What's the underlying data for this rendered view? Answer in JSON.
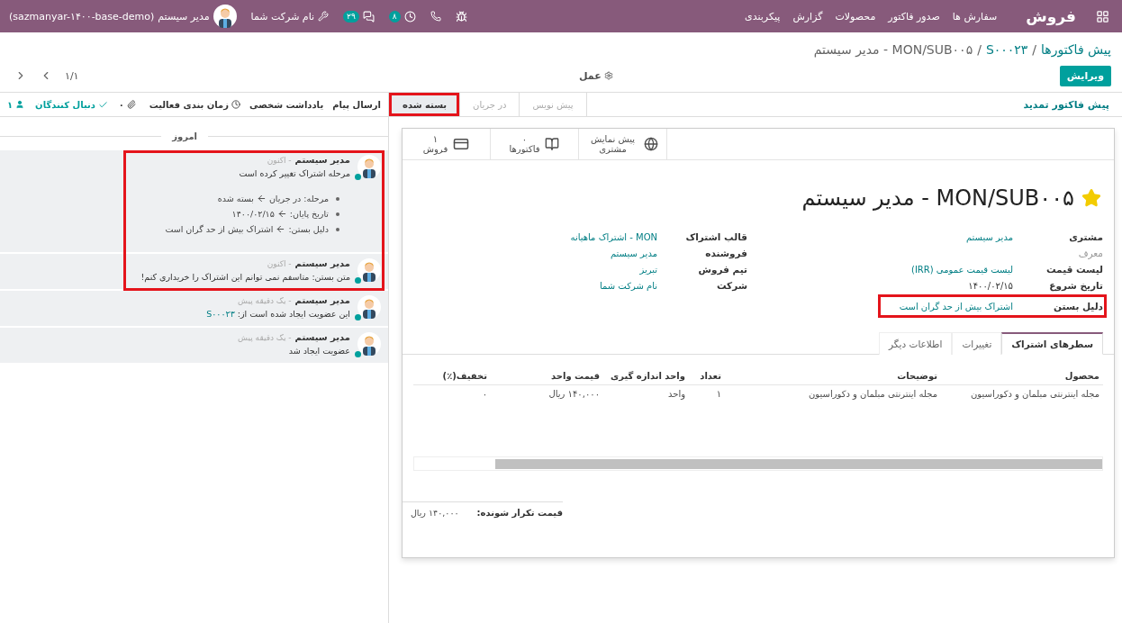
{
  "navbar": {
    "app_name": "فروش",
    "menu": [
      "سفارش ها",
      "صدور فاکتور",
      "محصولات",
      "گزارش",
      "پیکربندی"
    ],
    "systray": [
      {
        "kind": "bug"
      },
      {
        "kind": "phone"
      },
      {
        "kind": "activity",
        "badge": "۸"
      },
      {
        "kind": "messages",
        "badge": "۲۹"
      },
      {
        "kind": "company",
        "label": "نام شرکت شما"
      },
      {
        "kind": "user",
        "label": "مدیر سیستم",
        "db": "(sazmanyar-۱۴۰۰-base-demo)"
      }
    ]
  },
  "breadcrumbs": [
    {
      "label": "پیش فاکتورها",
      "link": true,
      "separator": "/"
    },
    {
      "label": "S۰۰۰۲۳",
      "link": true,
      "separator": "/"
    },
    {
      "label": "MON/SUB۰۰۵ - مدیر سیستم",
      "link": false
    }
  ],
  "edit_button": "ویرایش",
  "action_menu": "عمل",
  "pager": "۱/۱",
  "status_bar": {
    "button": "پیش فاکتور تمدید",
    "stages": [
      {
        "label": "پیش نویس",
        "selected": false,
        "highlighted": false
      },
      {
        "label": "در جریان",
        "selected": false,
        "highlighted": false
      },
      {
        "label": "بسته شده",
        "selected": true,
        "highlighted": true
      }
    ]
  },
  "stat_buttons": [
    {
      "kind": "globe",
      "label": "پیش نمایش مشتری"
    },
    {
      "kind": "book",
      "value": "۰",
      "label": "فاکتورها"
    },
    {
      "kind": "card",
      "value": "۱",
      "label": "فروش"
    }
  ],
  "title": "MON/SUB۰۰۵ - مدیر سیستم",
  "starred": true,
  "field_columns": [
    [
      {
        "label": "مشتری",
        "value": "مدیر سیستم",
        "link": true,
        "muted": false,
        "highlighted": false
      },
      {
        "label": "معرف",
        "muted": true,
        "highlighted": false
      },
      {
        "label": "لیست قیمت",
        "value": "لیست قیمت عمومی (IRR)",
        "link": true,
        "muted": false,
        "highlighted": false
      },
      {
        "label": "تاریخ شروع",
        "value": "۱۴۰۰/۰۲/۱۵",
        "link": false,
        "muted": false,
        "highlighted": false
      },
      {
        "label": "دلیل بستن",
        "value": "اشتراک بیش از حد گران است",
        "link": true,
        "muted": false,
        "highlighted": true
      }
    ],
    [
      {
        "label": "قالب اشتراک",
        "value": "MON - اشتراک ماهیانه",
        "link": true,
        "muted": false,
        "highlighted": false
      },
      {
        "label": "فروشنده",
        "value": "مدیر سیستم",
        "link": true,
        "muted": false,
        "highlighted": false
      },
      {
        "label": "تیم فروش",
        "value": "تبریز",
        "link": true,
        "muted": false,
        "highlighted": false
      },
      {
        "label": "شرکت",
        "value": "نام شرکت شما",
        "link": true,
        "muted": false,
        "highlighted": false
      }
    ]
  ],
  "tabs": [
    {
      "label": "سطرهای اشتراک",
      "selected": true
    },
    {
      "label": "تغییرات",
      "selected": false
    },
    {
      "label": "اطلاعات دیگر",
      "selected": false
    }
  ],
  "table": {
    "columns": [
      "محصول",
      "توضیحات",
      "تعداد",
      "واحد اندازه گیری",
      "قیمت واحد",
      "تخفیف(٪)"
    ],
    "rows": [
      [
        "مجله اینترنتی مبلمان و دکوراسیون",
        "مجله اینترنتی مبلمان و دکوراسیون",
        "۱",
        "واحد",
        "۱۴۰,۰۰۰ ریال",
        "۰"
      ]
    ]
  },
  "total": {
    "label": "قیمت تکرار شونده:",
    "value": "۱۴۰,۰۰۰ ریال"
  },
  "chatter": {
    "actions": [
      "ارسال پیام",
      "یادداشت شخصی",
      "زمان بندی فعالیت"
    ],
    "attachments": "۰",
    "follow": "دنبال کنندگان",
    "followers": "۱",
    "day": "امروز",
    "messages": [
      {
        "author": "مدیر سیستم",
        "time": "- اکنون",
        "body": "مرحله اشتراک تغییر کرده است",
        "highlighted": true,
        "tracking": [
          {
            "field": "مرحله:",
            "old": "در جریان",
            "new": "بسته شده"
          },
          {
            "field": "تاریخ پایان:",
            "new": "۱۴۰۰/۰۲/۱۵"
          },
          {
            "field": "دلیل بستن:",
            "new": "اشتراک بیش از حد گران است"
          }
        ]
      },
      {
        "author": "مدیر سیستم",
        "time": "- اکنون",
        "body": "متن بستن: متاسفم نمی توانم این اشتراک را خریداری کنم!",
        "highlighted": true
      },
      {
        "author": "مدیر سیستم",
        "time": "- یک دقیقه پیش",
        "body": "این عضویت ایجاد شده است از:",
        "link": "S۰۰۰۲۳",
        "highlighted": false
      },
      {
        "author": "مدیر سیستم",
        "time": "- یک دقیقه پیش",
        "body": "عضویت ایجاد شد",
        "highlighted": false
      }
    ]
  }
}
